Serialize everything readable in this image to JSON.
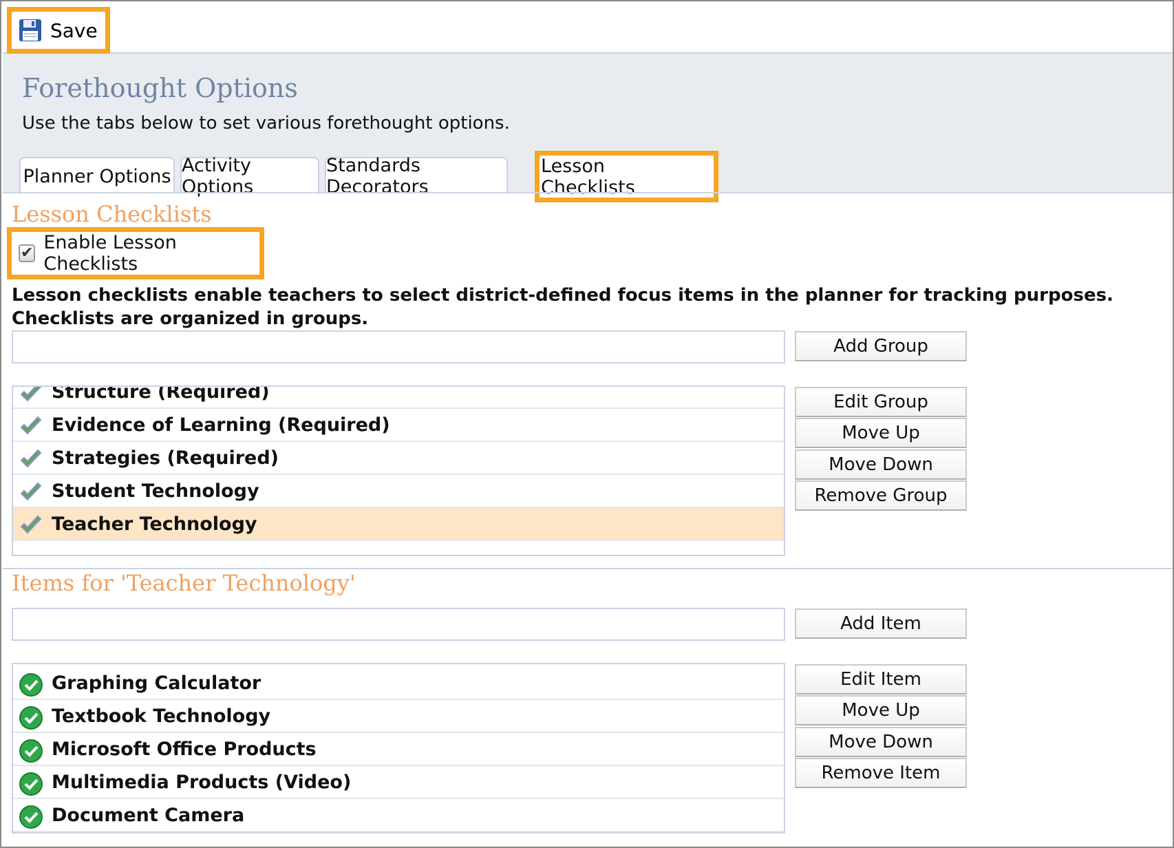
{
  "toolbar": {
    "save_label": "Save"
  },
  "header": {
    "title": "Forethought Options",
    "subtitle": "Use the tabs below to set various forethought options."
  },
  "tabs": [
    {
      "label": "Planner Options"
    },
    {
      "label": "Activity Options"
    },
    {
      "label": "Standards Decorators"
    },
    {
      "label": "Lesson Checklists",
      "active": true
    }
  ],
  "checklists": {
    "section_title": "Lesson Checklists",
    "enable_label": "Enable Lesson Checklists",
    "enable_checked": true,
    "description": "Lesson checklists enable teachers to select district-defined focus items in the planner for tracking purposes. Checklists are organized in groups.",
    "new_group_value": "",
    "add_group_label": "Add Group",
    "groups": [
      {
        "label": "Structure (Required)"
      },
      {
        "label": "Evidence of Learning (Required)"
      },
      {
        "label": "Strategies (Required)"
      },
      {
        "label": "Student Technology"
      },
      {
        "label": "Teacher Technology",
        "selected": true
      }
    ],
    "group_buttons": {
      "edit": "Edit Group",
      "up": "Move Up",
      "down": "Move Down",
      "remove": "Remove Group"
    }
  },
  "items": {
    "section_title": "Items for 'Teacher Technology'",
    "new_item_value": "",
    "add_item_label": "Add Item",
    "list": [
      {
        "label": "Graphing Calculator"
      },
      {
        "label": "Textbook Technology"
      },
      {
        "label": "Microsoft Office Products"
      },
      {
        "label": "Multimedia Products (Video)"
      },
      {
        "label": "Document Camera"
      }
    ],
    "item_buttons": {
      "edit": "Edit Item",
      "up": "Move Up",
      "down": "Move Down",
      "remove": "Remove Item"
    }
  },
  "colors": {
    "highlight": "#f5a623",
    "title_blue": "#6f84a4",
    "section_orange": "#f0a060",
    "selected_row": "#fde5c5"
  }
}
